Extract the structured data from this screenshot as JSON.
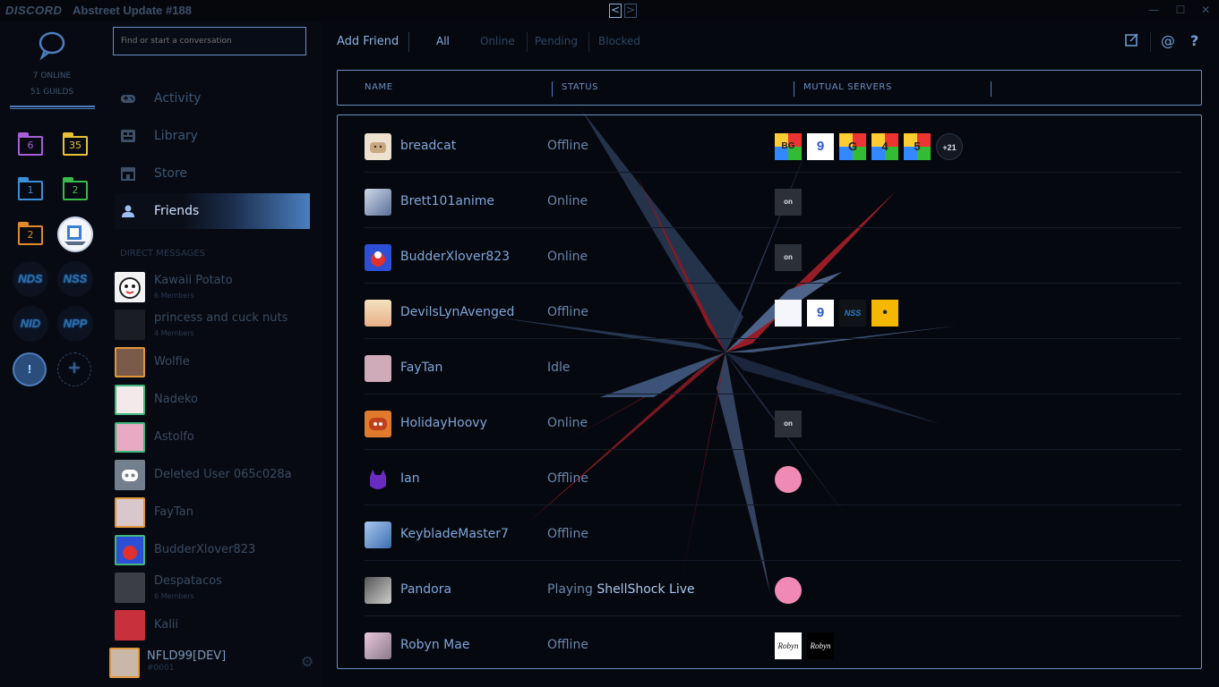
{
  "titlebar": {
    "logo": "DISCORD",
    "title": "Abstreet Update #188",
    "back": "<",
    "forward": ">",
    "minimize": "—",
    "maximize": "☐",
    "close": "✕"
  },
  "guilds": {
    "online": "7 ONLINE",
    "count": "51 GUILDS",
    "folders": [
      "6",
      "35",
      "1",
      "2",
      "2"
    ],
    "nds": "NDS",
    "nss": "NSS",
    "nid": "NID",
    "npp": "NPP",
    "alert": "!",
    "add": "+"
  },
  "search": {
    "placeholder": "Find or start a conversation"
  },
  "nav": [
    {
      "label": "Activity",
      "icon": "controller-icon"
    },
    {
      "label": "Library",
      "icon": "library-icon"
    },
    {
      "label": "Store",
      "icon": "store-icon"
    },
    {
      "label": "Friends",
      "icon": "friends-icon"
    }
  ],
  "dm_header": "DIRECT MESSAGES",
  "dms": [
    {
      "name": "Kawaii Potato",
      "sub": "6 Members"
    },
    {
      "name": "princess and cuck nuts",
      "sub": "4 Members"
    },
    {
      "name": "Wolfie",
      "sub": ""
    },
    {
      "name": "Nadeko",
      "sub": ""
    },
    {
      "name": "Astolfo",
      "sub": ""
    },
    {
      "name": "Deleted User 065c028a",
      "sub": ""
    },
    {
      "name": "FayTan",
      "sub": ""
    },
    {
      "name": "BudderXlover823",
      "sub": ""
    },
    {
      "name": "Despatacos",
      "sub": "6 Members"
    },
    {
      "name": "Kalii",
      "sub": ""
    }
  ],
  "user": {
    "name": "NFLD99[DEV]",
    "tag": "#0001"
  },
  "topnav": {
    "add_friend": "Add Friend",
    "tabs": [
      "All",
      "Online",
      "Pending",
      "Blocked"
    ]
  },
  "columns": {
    "name": "NAME",
    "status": "STATUS",
    "mutual": "MUTUAL SERVERS"
  },
  "friends": [
    {
      "name": "breadcat",
      "status": "Offline",
      "servers": [
        "BG",
        "9",
        "G",
        "4",
        "5"
      ],
      "more": "+21"
    },
    {
      "name": "Brett101anime",
      "status": "Online",
      "servers": [
        "on"
      ]
    },
    {
      "name": "BudderXlover823",
      "status": "Online",
      "servers": [
        "on"
      ]
    },
    {
      "name": "DevilsLynAvenged",
      "status": "Offline",
      "servers": [
        "",
        "9",
        "NSS",
        "•"
      ]
    },
    {
      "name": "FayTan",
      "status": "Idle",
      "servers": []
    },
    {
      "name": "HolidayHoovy",
      "status": "Online",
      "servers": [
        "on"
      ]
    },
    {
      "name": "Ian",
      "status": "Offline",
      "servers": [
        ""
      ]
    },
    {
      "name": "KeybladeMaster7",
      "status": "Offline",
      "servers": []
    },
    {
      "name": "Pandora",
      "status": "Playing",
      "game": "ShellShock Live",
      "servers": [
        ""
      ]
    },
    {
      "name": "Robyn Mae",
      "status": "Offline",
      "servers": [
        "Robyn",
        "Robyn"
      ]
    }
  ],
  "colors": {
    "accent": "#6a8fc2",
    "link": "#7fa6d8",
    "background": "#06080f"
  }
}
